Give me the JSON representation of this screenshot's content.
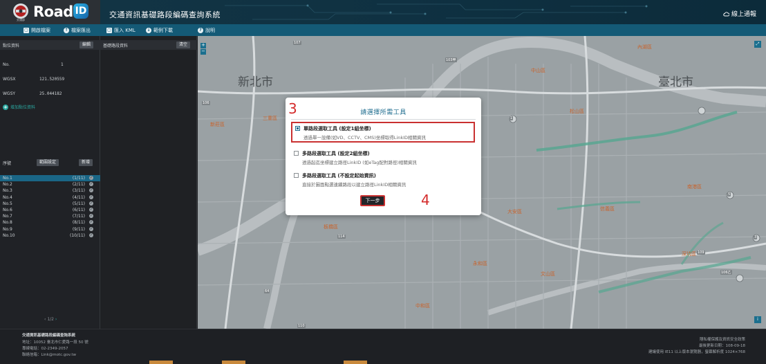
{
  "header": {
    "org_small": "交通部",
    "logo_text": "Road",
    "logo_badge": "ID",
    "app_title": "交通資訊基礎路段編碼查詢系統",
    "online_report": "線上通報"
  },
  "toolbar": {
    "open_file": "開啟檔案",
    "export_file": "檔案匯出",
    "import_kml": "匯入 KML",
    "sample_download": "範例下載",
    "help": "說明"
  },
  "left_panel": {
    "title": "點位資料",
    "edit_button": "編輯",
    "fields": [
      {
        "key": "No.",
        "value": "1"
      },
      {
        "key": "WGSX",
        "value": "121.520559"
      },
      {
        "key": "WGSY",
        "value": "25.044182"
      }
    ],
    "add_point": "增加點位資料",
    "seq_label": "序號",
    "range_button": "範圍設定",
    "new_button": "新增",
    "items": [
      {
        "no": "No.1",
        "count": "(1/11)"
      },
      {
        "no": "No.2",
        "count": "(2/11)"
      },
      {
        "no": "No.3",
        "count": "(3/11)"
      },
      {
        "no": "No.4",
        "count": "(4/11)"
      },
      {
        "no": "No.5",
        "count": "(5/11)"
      },
      {
        "no": "No.6",
        "count": "(6/11)"
      },
      {
        "no": "No.7",
        "count": "(7/11)"
      },
      {
        "no": "No.8",
        "count": "(8/11)"
      },
      {
        "no": "No.9",
        "count": "(9/11)"
      },
      {
        "no": "No.10",
        "count": "(10/11)"
      }
    ],
    "pager_prev": "‹",
    "pager_page": "1/2",
    "pager_next": "›"
  },
  "segment_panel": {
    "title": "基礎路段資料",
    "clear_button": "清空"
  },
  "map": {
    "labels": {
      "new_taipei": "新北市",
      "taipei": "臺北市",
      "neihu": "內湖區",
      "zhongshan": "中山區",
      "songshan": "松山區",
      "xinyi": "信義區",
      "daan": "大安區",
      "nangang": "南港區",
      "wenshan": "文山區",
      "shenkeng": "深坑區",
      "banqiao": "板橋區",
      "yonghe": "永和區",
      "zhonghe": "中和區",
      "sanchong": "三重區",
      "xinzhuang": "新莊區"
    },
    "roads": [
      "107",
      "106",
      "103甲",
      "1",
      "5",
      "3",
      "64",
      "114",
      "110",
      "109",
      "106乙"
    ]
  },
  "modal": {
    "step3": "3",
    "step4": "4",
    "title": "請選擇所需工具",
    "options": [
      {
        "title": "單路段選取工具 (設定1組坐標)",
        "desc": "透過單一設備(如VD、CCTV、CMS)坐標取得LinkID相關資訊"
      },
      {
        "title": "多路段選取工具 (設定2組坐標)",
        "desc": "透過起迄坐標建立路徑LinkID (如eTag配對路徑)相關資訊"
      },
      {
        "title": "多路段選取工具 (不設定起始資訊)",
        "desc": "直接於圖面點選連續路段以建立路徑LinkID相關資訊"
      }
    ],
    "next_button": "下一步"
  },
  "footer": {
    "left": [
      "交通資訊基礎路段編碼查詢系統",
      "地址：10052 臺北市仁愛路一段 50 號",
      "專線電話：02-2349-2057",
      "聯絡信箱：Link@motc.gov.tw"
    ],
    "right": [
      "隱私權保護及資訊安全政策",
      "最後更新日期：108-09-18",
      "建議使用 IE11 以上版本瀏覽器，螢幕解析度 1024×768"
    ]
  },
  "colors": {
    "header": "#0e2a36",
    "toolbar": "#145a76",
    "accent": "#1a6a8c",
    "highlight": "#c93030",
    "selected_row": "#1a6686"
  }
}
